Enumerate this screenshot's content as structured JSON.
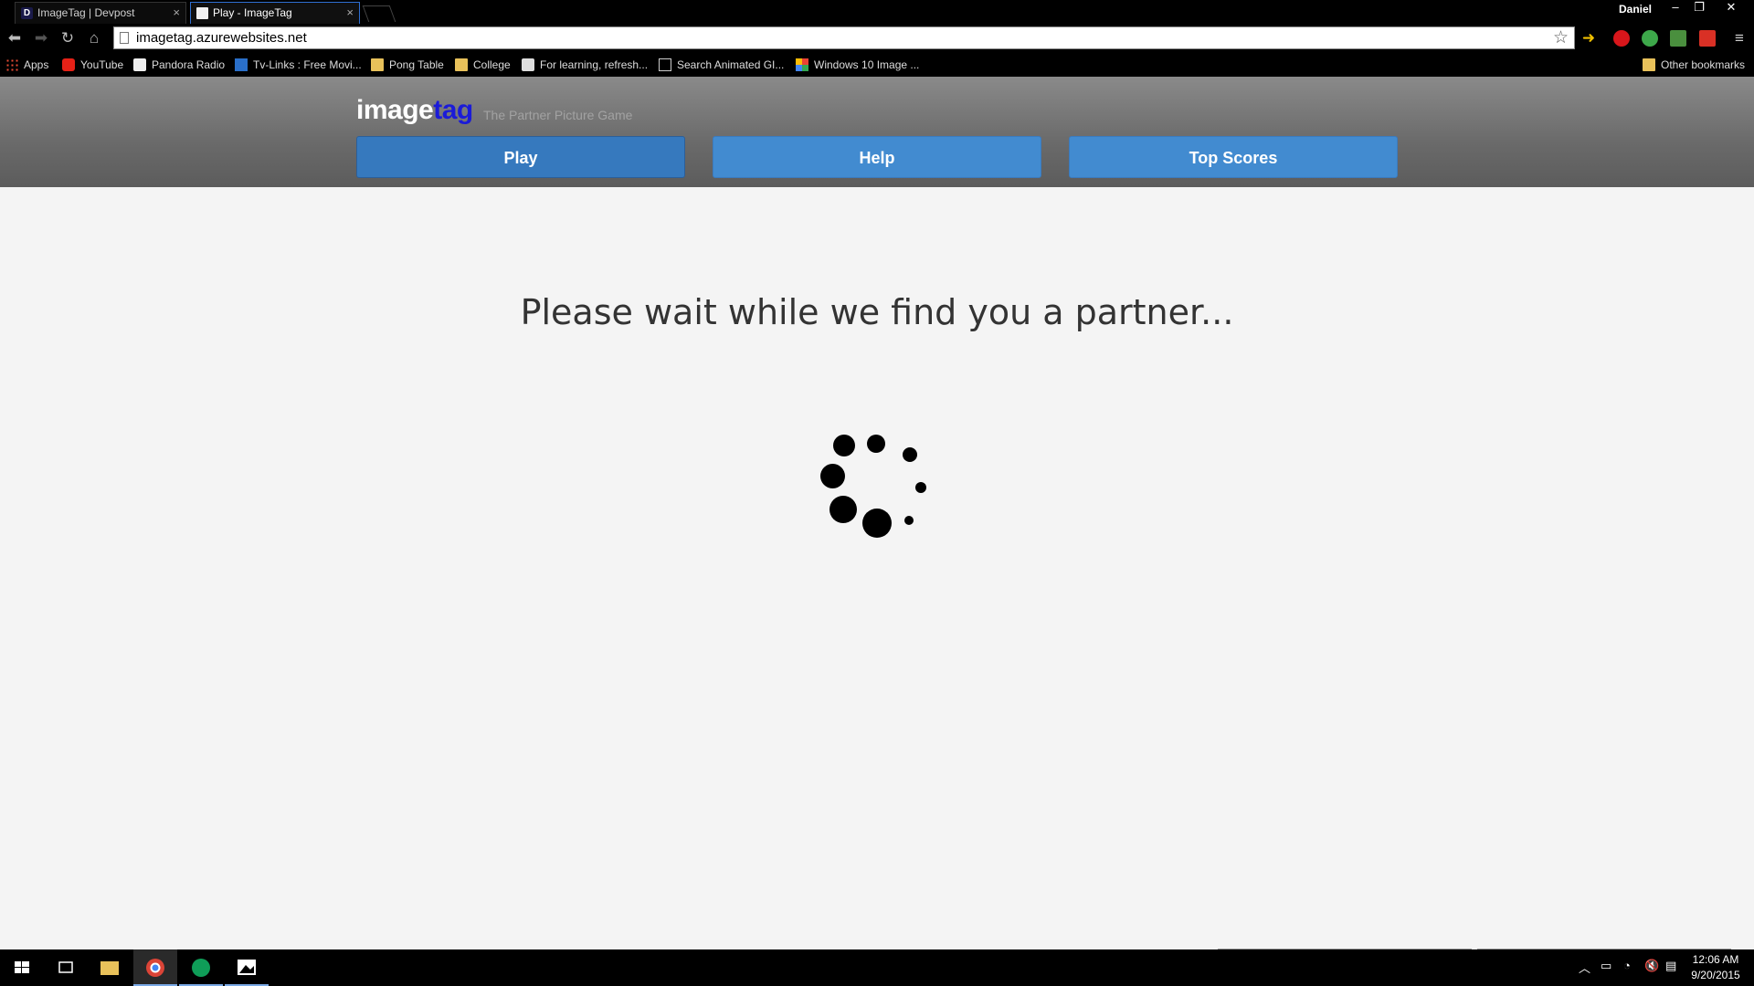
{
  "browser": {
    "tabs": [
      {
        "title": "ImageTag | Devpost",
        "favicon": "D"
      },
      {
        "title": "Play - ImageTag",
        "favicon": ""
      }
    ],
    "profile": "Daniel",
    "url": "imagetag.azurewebsites.net",
    "bookmarks": [
      {
        "label": "Apps",
        "icon": "apps-grid-icon"
      },
      {
        "label": "YouTube",
        "icon": "youtube-icon"
      },
      {
        "label": "Pandora Radio",
        "icon": "pandora-icon"
      },
      {
        "label": "Tv-Links : Free Movi...",
        "icon": "play-icon"
      },
      {
        "label": "Pong Table",
        "icon": "folder-icon"
      },
      {
        "label": "College",
        "icon": "folder-icon"
      },
      {
        "label": "For learning, refresh...",
        "icon": "web-icon"
      },
      {
        "label": "Search Animated GI...",
        "icon": "page-icon"
      },
      {
        "label": "Windows 10 Image ...",
        "icon": "windows-icon"
      }
    ],
    "other_bookmarks": "Other bookmarks"
  },
  "site": {
    "logo_part1": "image",
    "logo_part2": "tag",
    "tagline": "The Partner Picture Game",
    "nav": {
      "play": "Play",
      "help": "Help",
      "top_scores": "Top Scores"
    },
    "wait_message": "Please wait while we find you a partner..."
  },
  "taskbar": {
    "time": "12:06 AM",
    "date": "9/20/2015"
  },
  "colors": {
    "play_button": "#3679be",
    "nav_button": "#428bd0",
    "logo_tag": "#1b1bd8"
  }
}
